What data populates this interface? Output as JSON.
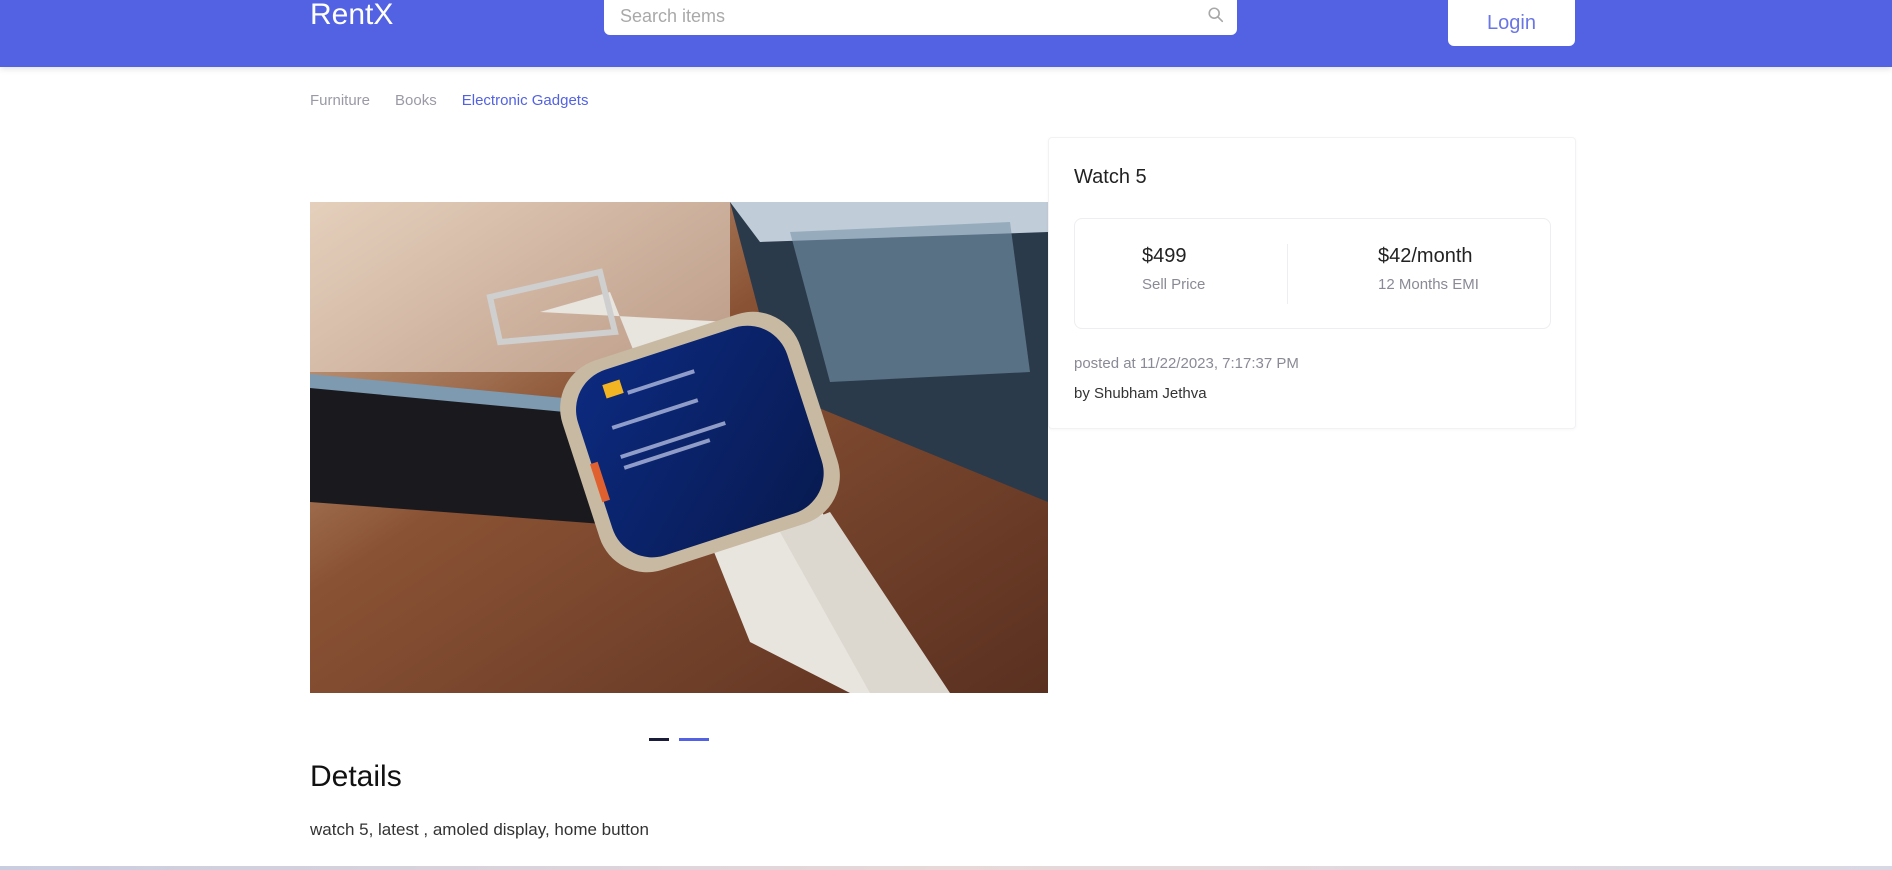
{
  "header": {
    "brand": "RentX",
    "search_placeholder": "Search items",
    "search_value": "",
    "login_label": "Login",
    "accent_color": "#5262e2"
  },
  "categories": [
    {
      "label": "Furniture",
      "active": false
    },
    {
      "label": "Books",
      "active": false
    },
    {
      "label": "Electronic Gadgets",
      "active": true
    }
  ],
  "product": {
    "image_alt": "Watch 5 photo - smartwatch with white band on wooden table",
    "carousel": {
      "count": 2,
      "active_index": 0
    },
    "title": "Watch 5",
    "sell_price": "$499",
    "sell_price_label": "Sell Price",
    "emi": "$42/month",
    "emi_label": "12 Months EMI",
    "posted": "posted at 11/22/2023, 7:17:37 PM",
    "by": "by Shubham Jethva",
    "details_heading": "Details",
    "details_text": "watch 5, latest , amoled display, home button"
  }
}
